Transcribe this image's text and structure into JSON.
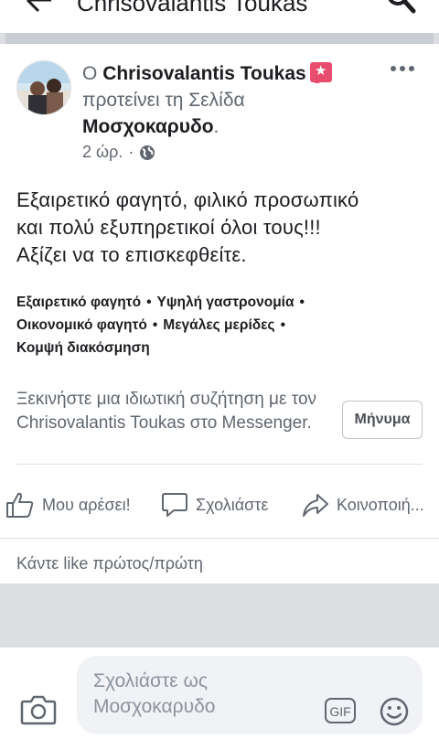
{
  "topbar": {
    "title": "Chrisovalantis Toukas",
    "back_icon": "arrow-left-icon",
    "search_icon": "search-icon"
  },
  "post": {
    "prefix": "Ο",
    "author": "Chrisovalantis Toukas",
    "badge_icon": "recommend-star-icon",
    "action_text": "προτείνει τη Σελίδα",
    "page_name": "Μοσχοκαρυδο",
    "page_suffix": ".",
    "time": "2 ώρ.",
    "separator": "·",
    "privacy_icon": "globe-icon",
    "more_icon": "more-dots-icon",
    "body_lines": [
      "Εξαιρετικό φαγητό, φιλικό προσωπικό",
      "και πολύ εξυπηρετικοί όλοι τους!!!",
      "Αξίζει να το επισκεφθείτε."
    ],
    "tags": [
      "Εξαιρετικό φαγητό",
      "Υψηλή γαστρονομία",
      "Οικονομικό φαγητό",
      "Μεγάλες μερίδες",
      "Κομψή διακόσμηση"
    ],
    "tag_separator": "•",
    "messenger": {
      "text": "Ξεκινήστε μια ιδιωτική συζήτηση με τον Chrisovalantis Toukas στο Messenger.",
      "button_label": "Μήνυμα"
    },
    "actions": {
      "like": "Μου αρέσει!",
      "comment": "Σχολιάστε",
      "share": "Κοινοποιή..."
    },
    "like_first": "Κάντε like πρώτος/πρώτη"
  },
  "composer": {
    "placeholder_line1": "Σχολιάστε ως",
    "placeholder_line2": "Μοσχοκαρυδο",
    "camera_icon": "camera-icon",
    "gif_label": "GIF",
    "emoji_icon": "emoji-icon"
  },
  "colors": {
    "secondary_text": "#606770",
    "primary_text": "#1c1e21",
    "badge": "#e84c6e",
    "separator": "#c9ccd1"
  }
}
